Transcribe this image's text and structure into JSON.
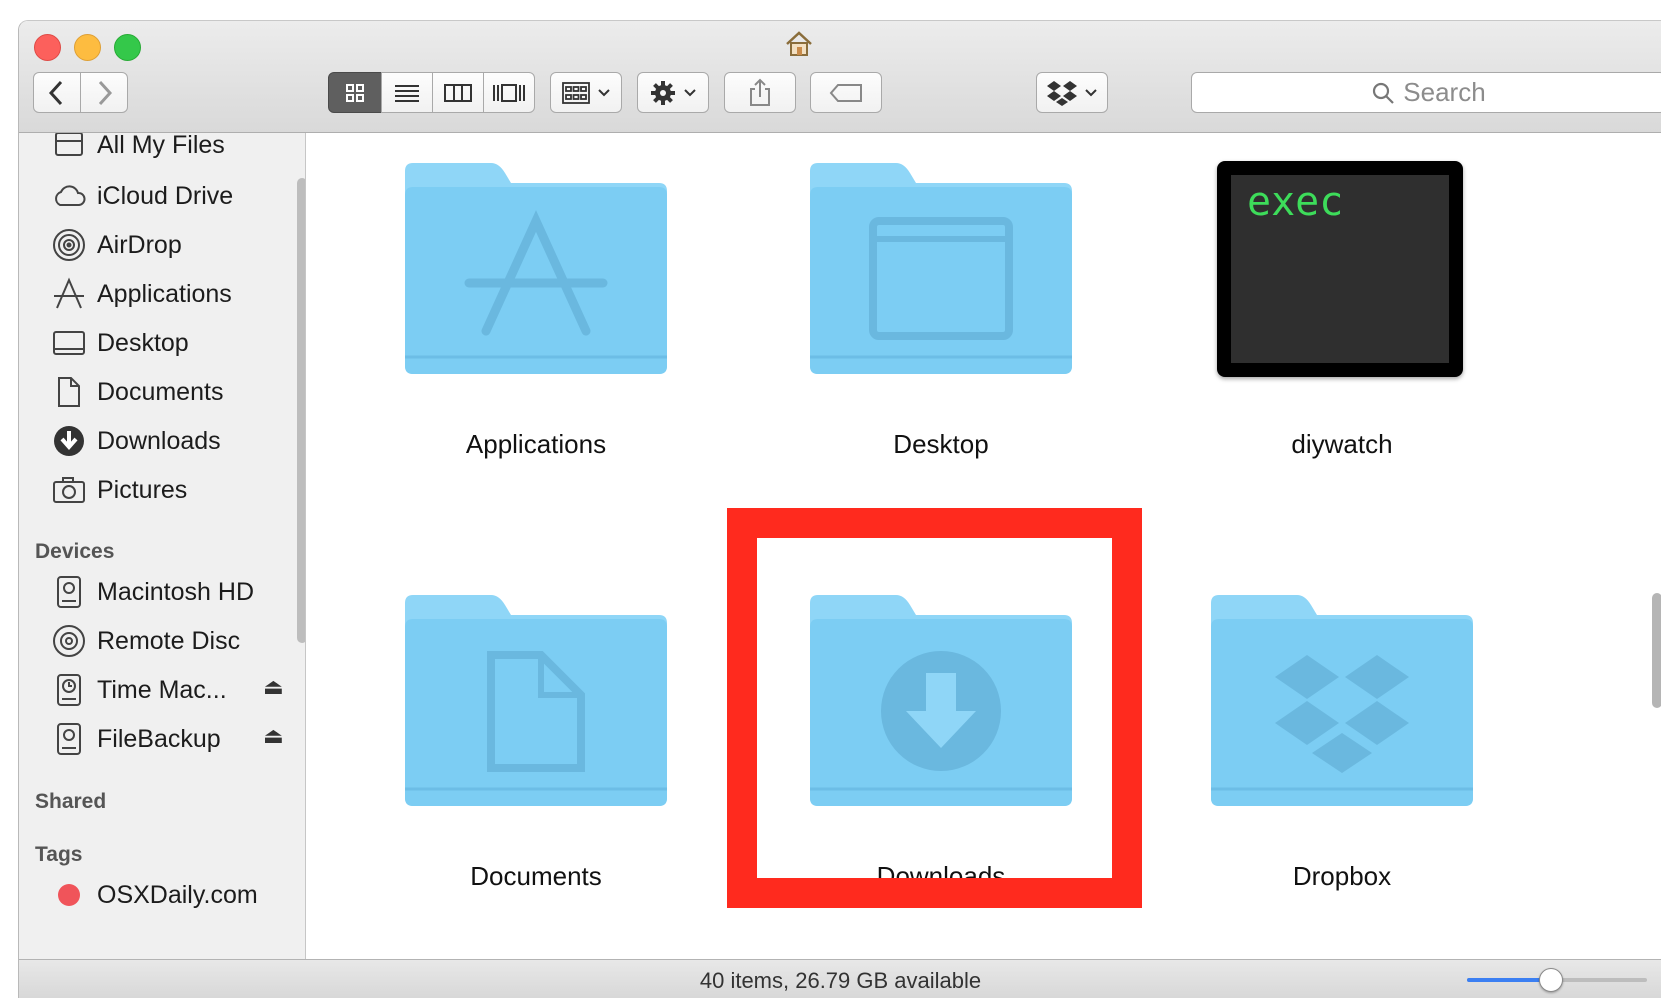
{
  "toolbar": {
    "search_placeholder": "Search"
  },
  "sidebar": {
    "favorites": [
      {
        "label": "All My Files",
        "icon": "all-my-files-icon"
      },
      {
        "label": "iCloud Drive",
        "icon": "cloud-icon"
      },
      {
        "label": "AirDrop",
        "icon": "airdrop-icon"
      },
      {
        "label": "Applications",
        "icon": "applications-icon"
      },
      {
        "label": "Desktop",
        "icon": "desktop-icon"
      },
      {
        "label": "Documents",
        "icon": "documents-icon"
      },
      {
        "label": "Downloads",
        "icon": "downloads-icon"
      },
      {
        "label": "Pictures",
        "icon": "camera-icon"
      }
    ],
    "devices_header": "Devices",
    "devices": [
      {
        "label": "Macintosh HD",
        "icon": "hard-drive-icon"
      },
      {
        "label": "Remote Disc",
        "icon": "disc-icon"
      },
      {
        "label": "Time Mac...",
        "icon": "time-machine-icon",
        "eject": "⏏"
      },
      {
        "label": "FileBackup",
        "icon": "hard-drive-icon",
        "eject": "⏏"
      }
    ],
    "shared_header": "Shared",
    "tags_header": "Tags",
    "tags": [
      {
        "label": "OSXDaily.com",
        "color": "#f0545a"
      }
    ]
  },
  "content": {
    "items": [
      {
        "label": "Applications",
        "icon": "applications-folder-icon"
      },
      {
        "label": "Desktop",
        "icon": "desktop-folder-icon"
      },
      {
        "label": "diywatch",
        "icon": "exec-icon",
        "icon_text": "exec"
      },
      {
        "label": "Documents",
        "icon": "documents-folder-icon"
      },
      {
        "label": "Downloads",
        "icon": "downloads-folder-icon",
        "highlighted": true
      },
      {
        "label": "Dropbox",
        "icon": "dropbox-folder-icon"
      }
    ]
  },
  "status": {
    "text": "40 items, 26.79 GB available",
    "icon_size_fraction": 0.46
  },
  "colors": {
    "highlight": "#ff2a1e",
    "folder": "#7ccdf3",
    "exec_text": "#3ddc5a"
  }
}
